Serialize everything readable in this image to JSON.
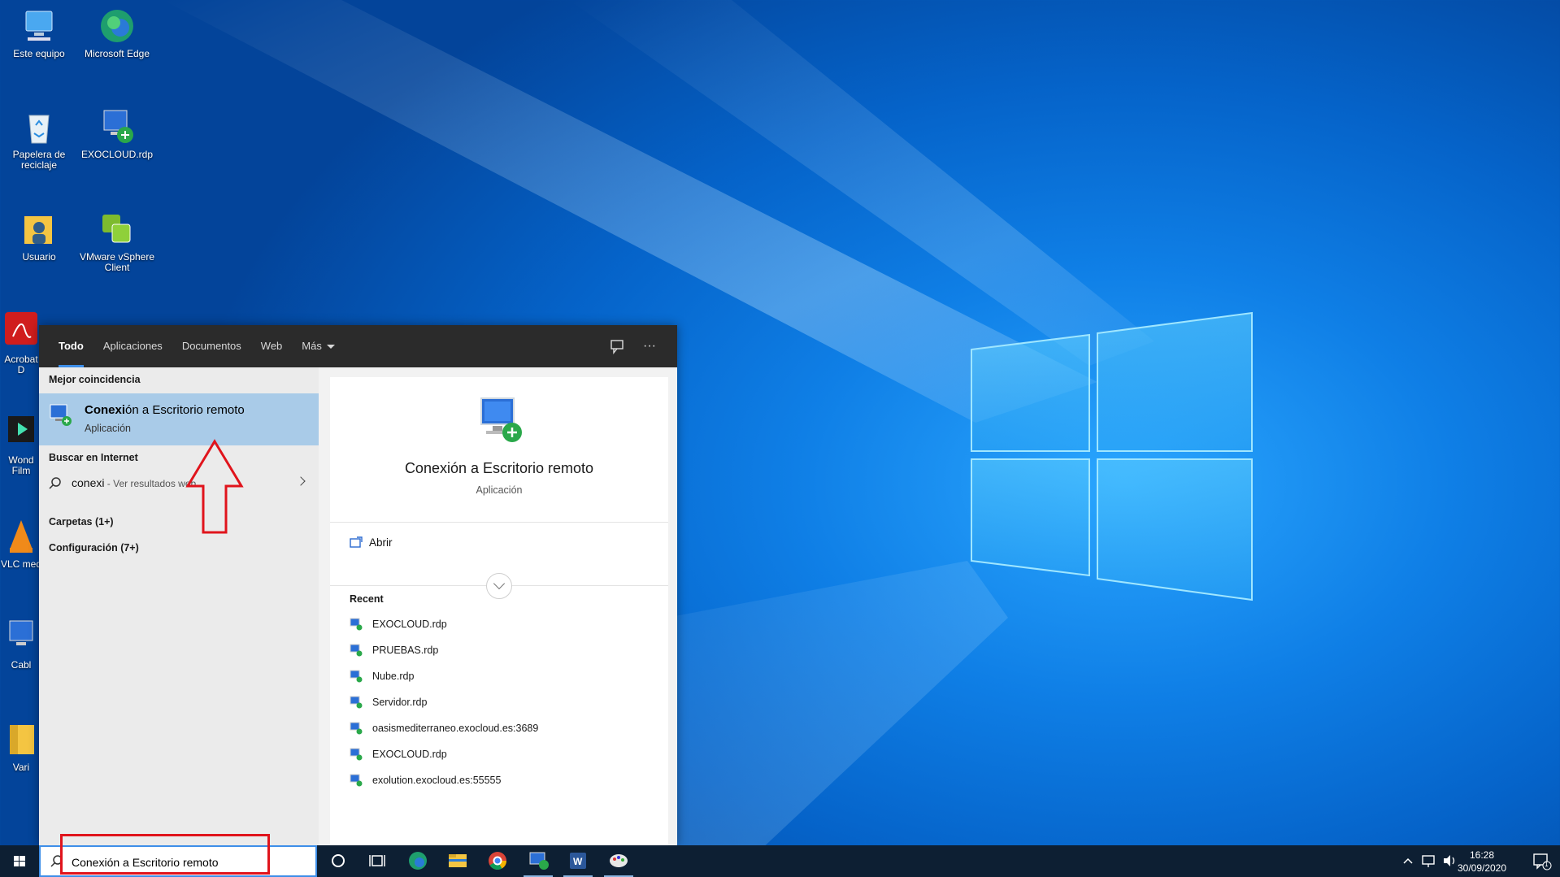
{
  "desktop": {
    "icons": [
      {
        "label": "Este equipo"
      },
      {
        "label": "Microsoft Edge"
      },
      {
        "label": "Papelera de reciclaje"
      },
      {
        "label": "EXOCLOUD.rdp"
      },
      {
        "label": "Usuario"
      },
      {
        "label": "VMware vSphere Client"
      },
      {
        "label": "Acrobat D"
      },
      {
        "label": "Wond Film"
      },
      {
        "label": "VLC med"
      },
      {
        "label": "Cabl"
      },
      {
        "label": "Vari"
      }
    ]
  },
  "search_panel": {
    "tabs": [
      {
        "label": "Todo",
        "active": true
      },
      {
        "label": "Aplicaciones"
      },
      {
        "label": "Documentos"
      },
      {
        "label": "Web"
      },
      {
        "label": "Más"
      }
    ],
    "feedback_icon": "feedback-icon",
    "more_label": "···",
    "best_match_title": "Mejor coincidencia",
    "best_match": {
      "name_bold": "Conexi",
      "name_rest": "ón a Escritorio remoto",
      "type": "Aplicación"
    },
    "web_title": "Buscar en Internet",
    "web_query": "conexi",
    "web_hint": " - Ver resultados web",
    "folders": "Carpetas (1+)",
    "settings": "Configuración (7+)",
    "detail": {
      "name": "Conexión a Escritorio remoto",
      "type": "Aplicación",
      "open_label": "Abrir",
      "recent_title": "Recent",
      "recent": [
        "EXOCLOUD.rdp",
        "PRUEBAS.rdp",
        "Nube.rdp",
        "Servidor.rdp",
        "oasismediterraneo.exocloud.es:3689",
        "EXOCLOUD.rdp",
        "exolution.exocloud.es:55555"
      ]
    }
  },
  "taskbar": {
    "search_value": "Conexión a Escritorio remoto",
    "time": "16:28",
    "date": "30/09/2020",
    "notification_count": "1"
  },
  "colors": {
    "accent": "#3d8ee8",
    "annotation_red": "#e0141c",
    "selected_row": "#a9cbe8"
  }
}
